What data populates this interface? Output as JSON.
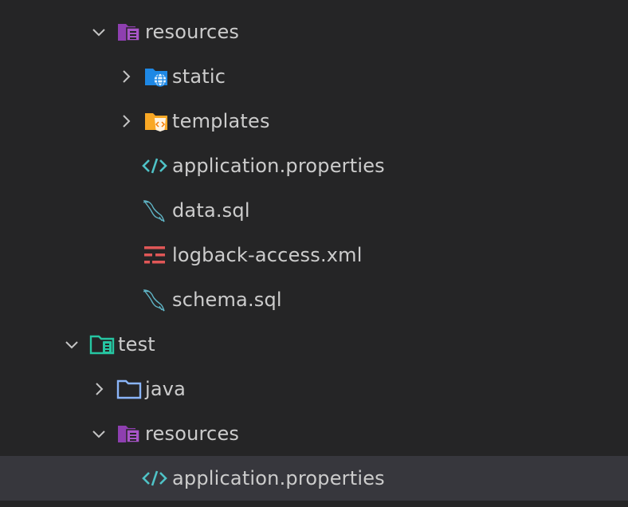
{
  "explorer": {
    "items": [
      {
        "label": "resources",
        "kind": "folder-resources",
        "expanded": true,
        "icon": "resources-folder-icon"
      },
      {
        "label": "static",
        "kind": "folder-static",
        "expanded": false,
        "icon": "web-folder-icon"
      },
      {
        "label": "templates",
        "kind": "folder-templates",
        "expanded": false,
        "icon": "templates-folder-icon"
      },
      {
        "label": "application.properties",
        "kind": "file-properties",
        "icon": "code-brackets-icon"
      },
      {
        "label": "data.sql",
        "kind": "file-sql",
        "icon": "mysql-dolphin-icon"
      },
      {
        "label": "logback-access.xml",
        "kind": "file-xml",
        "icon": "logback-icon"
      },
      {
        "label": "schema.sql",
        "kind": "file-sql",
        "icon": "mysql-dolphin-icon"
      },
      {
        "label": "test",
        "kind": "folder-test",
        "expanded": true,
        "icon": "test-folder-icon"
      },
      {
        "label": "java",
        "kind": "folder-java",
        "expanded": false,
        "icon": "folder-icon"
      },
      {
        "label": "resources",
        "kind": "folder-resources",
        "expanded": true,
        "icon": "resources-folder-icon"
      },
      {
        "label": "application.properties",
        "kind": "file-properties",
        "icon": "code-brackets-icon",
        "selected": true
      }
    ]
  },
  "colors": {
    "background": "#252526",
    "selected_row": "#37373d",
    "text": "#cccccc",
    "resources_folder": "#a855c8",
    "static_folder": "#1e88e5",
    "templates_folder": "#f9a825",
    "properties_icon": "#4fc3c7",
    "sql_icon": "#5fb3c4",
    "xml_icon": "#e05757",
    "test_folder": "#26c6a2",
    "java_folder": "#8ab4f8"
  }
}
